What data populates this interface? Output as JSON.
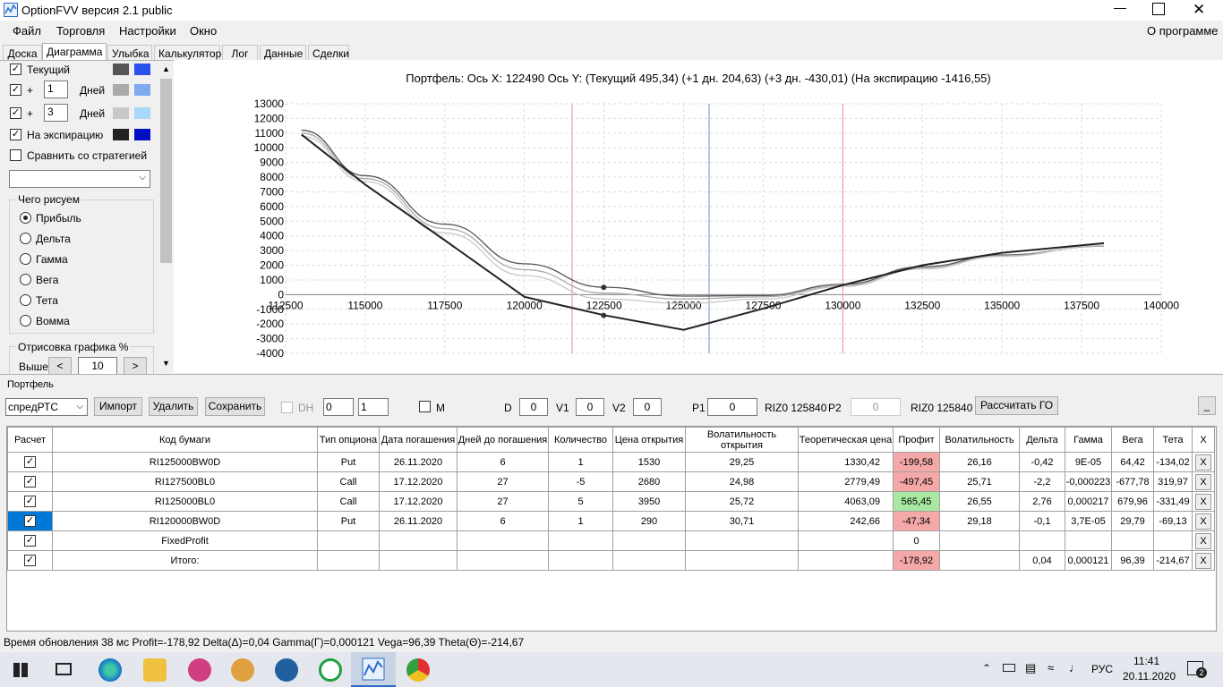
{
  "window": {
    "title": "OptionFVV версия 2.1 public"
  },
  "menu": {
    "items": [
      "Файл",
      "Торговля",
      "Настройки",
      "Окно"
    ],
    "about": "О программе"
  },
  "tabs": [
    "Доска",
    "Диаграмма",
    "Улыбка",
    "Калькулятор",
    "Лог",
    "Данные",
    "Сделки"
  ],
  "left": {
    "current_label": "Текущий",
    "plus": "+",
    "days_label": "Дней",
    "day1_value": "1",
    "day3_value": "3",
    "expiry_label": "На экспирацию",
    "compare_label": "Сравнить со стратегией",
    "group_title": "Чего рисуем",
    "radios": [
      "Прибыль",
      "Дельта",
      "Гамма",
      "Вега",
      "Тета",
      "Вомма"
    ],
    "render_title": "Отрисовка графика %",
    "above_label": "Выше",
    "above_value": "10",
    "prev": "<",
    "next": ">"
  },
  "chart_header": "Портфель:  Ось  X:  122490  Ось  Y:   (Текущий 495,34)  (+1 дн. 204,63)  (+3 дн. -430,01)  (На экспирацию -1416,55)",
  "chart_data": {
    "type": "line",
    "x": [
      113000,
      115000,
      117500,
      120000,
      122500,
      125000,
      127500,
      130000,
      132500,
      135000,
      138200
    ],
    "xlim": [
      112500,
      140000
    ],
    "ylim": [
      -4000,
      13000
    ],
    "x_ticks": [
      "112500",
      "115000",
      "117500",
      "120000",
      "122500",
      "125000",
      "127500",
      "130000",
      "132500",
      "135000",
      "137500",
      "140000"
    ],
    "y_ticks": [
      "13000",
      "12000",
      "11000",
      "10000",
      "9000",
      "8000",
      "7000",
      "6000",
      "5000",
      "4000",
      "3000",
      "2000",
      "1000",
      "0",
      "-1000",
      "-2000",
      "-3000",
      "-4000"
    ],
    "series": [
      {
        "values": [
          11200,
          8100,
          4800,
          2100,
          500,
          -100,
          -60,
          700,
          1900,
          2700,
          3300
        ],
        "color": "#555555"
      },
      {
        "values": [
          11000,
          7900,
          4500,
          1700,
          100,
          -300,
          -150,
          600,
          1800,
          2650,
          3300
        ],
        "color": "#aaaaaa"
      },
      {
        "values": [
          10800,
          7700,
          4200,
          1300,
          -300,
          -600,
          -300,
          550,
          1750,
          2600,
          3350
        ],
        "color": "#c8c8c8"
      },
      {
        "values": [
          10900,
          7500,
          3700,
          -150,
          -1400,
          -2400,
          -950,
          650,
          2000,
          2850,
          3500
        ],
        "color": "#222222"
      }
    ],
    "vlines": [
      {
        "x": 121500,
        "color": "#e89090"
      },
      {
        "x": 125800,
        "color": "#7090b8"
      },
      {
        "x": 130000,
        "color": "#e89090"
      }
    ],
    "markers": [
      {
        "x": 122490,
        "y": 495
      },
      {
        "x": 122490,
        "y": -1417
      }
    ],
    "grid": true
  },
  "portfolio": {
    "title": "Портфель",
    "strategy": "спредРТС",
    "import": "Импорт",
    "delete": "Удалить",
    "save": "Сохранить",
    "dh": "DH",
    "spin1": "0",
    "spin2": "1",
    "m": "M",
    "d_label": "D",
    "d_value": "0",
    "v1_label": "V1",
    "v1_value": "0",
    "v2_label": "V2",
    "v2_value": "0",
    "p1_label": "P1",
    "p1_value": "0",
    "fut1": "RIZ0 125840",
    "p2_label": "P2",
    "p2_value": "0",
    "fut2": "RIZ0 125840",
    "calc_go": "Рассчитать ГО",
    "min": "_"
  },
  "table": {
    "headers": [
      "Расчет",
      "Код бумаги",
      "Тип опциона",
      "Дата погашения",
      "Дней до погашения",
      "Количество",
      "Цена открытия",
      "Волатильность открытия",
      "Теоретическая цена",
      "Профит",
      "Волатильность",
      "Дельта",
      "Гамма",
      "Вега",
      "Тета",
      "X"
    ],
    "rows": [
      [
        "RI125000BW0D",
        "Put",
        "26.11.2020",
        "6",
        "1",
        "1530",
        "29,25",
        "1330,42",
        "-199,58",
        "26,16",
        "-0,42",
        "9E-05",
        "64,42",
        "-134,02",
        "X"
      ],
      [
        "RI127500BL0",
        "Call",
        "17.12.2020",
        "27",
        "-5",
        "2680",
        "24,98",
        "2779,49",
        "-497,45",
        "25,71",
        "-2,2",
        "-0,000223",
        "-677,78",
        "319,97",
        "X"
      ],
      [
        "RI125000BL0",
        "Call",
        "17.12.2020",
        "27",
        "5",
        "3950",
        "25,72",
        "4063,09",
        "565,45",
        "26,55",
        "2,76",
        "0,000217",
        "679,96",
        "-331,49",
        "X"
      ],
      [
        "RI120000BW0D",
        "Put",
        "26.11.2020",
        "6",
        "1",
        "290",
        "30,71",
        "242,66",
        "-47,34",
        "29,18",
        "-0,1",
        "3,7E-05",
        "29,79",
        "-69,13",
        "X"
      ],
      [
        "FixedProfit",
        "",
        "",
        "",
        "",
        "",
        "",
        "",
        "0",
        "",
        "",
        "",
        "",
        "",
        "X"
      ],
      [
        "Итого:",
        "",
        "",
        "",
        "",
        "",
        "",
        "",
        "-178,92",
        "",
        "0,04",
        "0,000121",
        "96,39",
        "-214,67",
        "X"
      ]
    ]
  },
  "status": "Время обновления 38 мс   Profit=-178,92 Delta(Δ)=0,04 Gamma(Γ)=0,000121 Vega=96,39 Theta(Θ)=-214,67",
  "taskbar": {
    "lang": "РУС",
    "time": "11:41",
    "date": "20.11.2020",
    "notif": "2"
  }
}
